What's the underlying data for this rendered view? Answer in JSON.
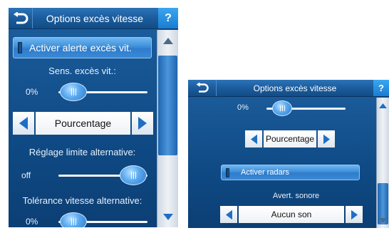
{
  "screen1": {
    "title": "Options excès vitesse",
    "help_label": "?",
    "toggle_label": "Activer alerte excès vit.",
    "sensitivity_label": "Sens. excès vit.:",
    "sensitivity_value": "0%",
    "sensitivity_fraction": 0.0,
    "mode_value": "Pourcentage",
    "alt_limit_label": "Réglage limite alternative:",
    "alt_limit_value": "off",
    "alt_limit_fraction": 1.0,
    "alt_tolerance_label": "Tolérance vitesse alternative:",
    "alt_tolerance_value": "0%",
    "alt_tolerance_fraction": 0.0
  },
  "screen2": {
    "title": "Options excès vitesse",
    "help_label": "?",
    "slider_value": "0%",
    "slider_fraction": 0.0,
    "mode_value": "Pourcentage",
    "toggle_label": "Activer radars",
    "sound_label": "Avert. sonore",
    "sound_value": "Aucun son"
  },
  "colors": {
    "background": "#1d5f9e",
    "accent": "#2a7bcf",
    "arrow": "#1e6fc4"
  },
  "icons": [
    "back-arrow-icon",
    "help-icon",
    "scroll-up-icon",
    "scroll-down-icon",
    "arrow-left-icon",
    "arrow-right-icon"
  ]
}
